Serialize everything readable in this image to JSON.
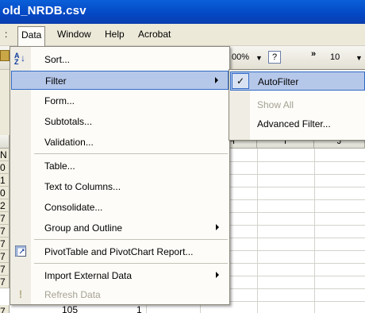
{
  "window": {
    "title": "old_NRDB.csv"
  },
  "menubar": {
    "fragment": ":",
    "data": "Data",
    "window": "Window",
    "help": "Help",
    "acrobat": "Acrobat"
  },
  "toolbar": {
    "zoom": "00%",
    "help_glyph": "?",
    "font_size": "10"
  },
  "data_menu": {
    "items": {
      "sort": "Sort...",
      "filter": "Filter",
      "form": "Form...",
      "subtotals": "Subtotals...",
      "validation": "Validation...",
      "table": "Table...",
      "text_to_columns": "Text to Columns...",
      "consolidate": "Consolidate...",
      "group_outline": "Group and Outline",
      "pivottable": "PivotTable and PivotChart Report...",
      "import_external": "Import External Data",
      "refresh": "Refresh Data"
    }
  },
  "filter_submenu": {
    "autofilter": "AutoFilter",
    "show_all": "Show All",
    "advanced_filter": "Advanced Filter..."
  },
  "sheet": {
    "columns": {
      "h": "H",
      "i": "I",
      "j": "J"
    },
    "row_fragments": [
      "N",
      "0",
      "1",
      "0",
      "2",
      "7",
      "7",
      "7",
      "7",
      "7",
      "7"
    ],
    "bottom_row": {
      "row": "7",
      "value": "105",
      "second": "1"
    }
  },
  "colors": {
    "highlight": "#b6c8ea",
    "highlight_border": "#316ac5",
    "menu_bg": "#fdfcf8",
    "titlebar": "#0447c4"
  }
}
